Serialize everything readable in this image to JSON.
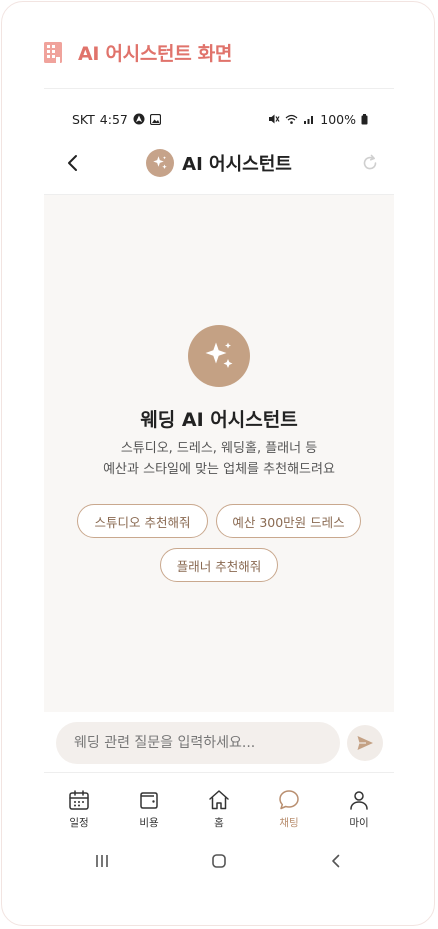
{
  "doc": {
    "title": "AI 어시스턴트 화면"
  },
  "status_bar": {
    "carrier": "SKT",
    "time": "4:57",
    "battery": "100%"
  },
  "navbar": {
    "title": "AI 어시스턴트"
  },
  "welcome": {
    "title": "웨딩 AI 어시스턴트",
    "desc_line1": "스튜디오, 드레스, 웨딩홀, 플래너 등",
    "desc_line2": "예산과 스타일에 맞는 업체를 추천해드려요"
  },
  "suggestions": [
    "스튜디오 추천해줘",
    "예산 300만원 드레스",
    "플래너 추천해줘"
  ],
  "input": {
    "placeholder": "웨딩 관련 질문을 입력하세요..."
  },
  "tabs": [
    {
      "label": "일정",
      "icon": "calendar-icon",
      "active": false
    },
    {
      "label": "비용",
      "icon": "wallet-icon",
      "active": false
    },
    {
      "label": "홈",
      "icon": "home-icon",
      "active": false
    },
    {
      "label": "채팅",
      "icon": "chat-icon",
      "active": true
    },
    {
      "label": "마이",
      "icon": "person-icon",
      "active": false
    }
  ],
  "colors": {
    "accent": "#c4a184",
    "title_red": "#e0736b",
    "content_bg": "#f9f7f5"
  }
}
